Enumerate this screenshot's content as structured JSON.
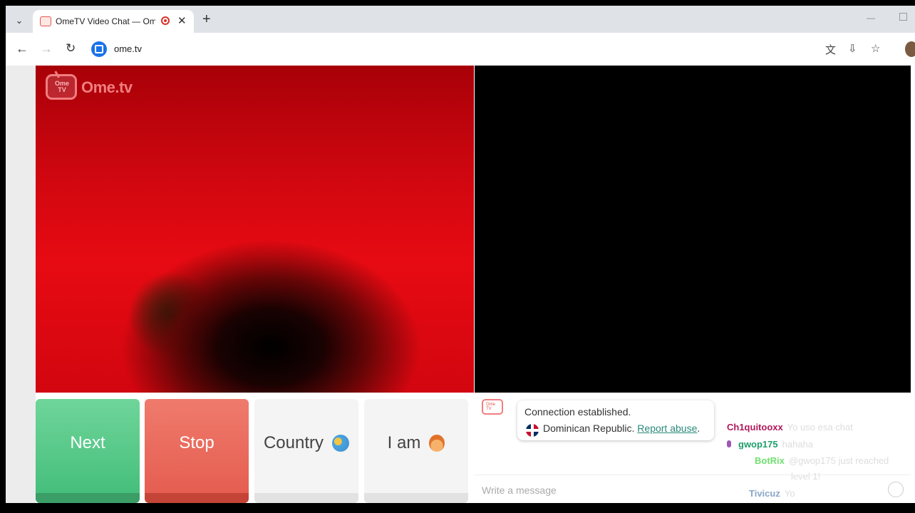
{
  "browser": {
    "tab_title": "OmeTV Video Chat — Ome",
    "new_tab_label": "+",
    "url": "ome.tv"
  },
  "logo": {
    "tv_text": "Ome TV",
    "text": "Ome.tv"
  },
  "controls": {
    "next_label": "Next",
    "stop_label": "Stop",
    "country_label": "Country",
    "iam_label": "I am"
  },
  "chat": {
    "logo_text": "Ome TV",
    "system_message": "Connection established.",
    "country": "Dominican Republic.",
    "report_label": "Report abuse",
    "report_suffix": ".",
    "input_placeholder": "Write a message"
  },
  "stream_overlay": [
    {
      "user": "Ch1quitooxx",
      "text": "Yo uso esa chat",
      "color": "#b0185a"
    },
    {
      "user": "gwop175",
      "text": "hahaha",
      "color": "#1e9e6b"
    },
    {
      "user": "BotRix",
      "text": "@gwop175 just reached",
      "color": "#6fe06f"
    },
    {
      "user": "",
      "text": "level 1!",
      "color": "#dddddd"
    },
    {
      "user": "Tivicuz",
      "text": "Yo",
      "color": "#8aa6c8"
    }
  ],
  "colors": {
    "next": "#46bf7c",
    "stop": "#e55e51",
    "accent": "#f17e80"
  }
}
